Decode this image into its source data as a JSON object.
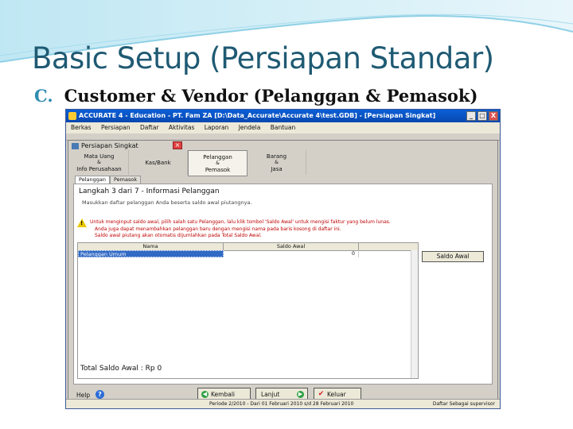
{
  "slide": {
    "title": "Basic Setup (Persiapan Standar)",
    "subtitle_letter": "C.",
    "subtitle": "Customer & Vendor (Pelanggan & Pemasok)",
    "accent_color": "#2f8cb0"
  },
  "window": {
    "title": "ACCURATE 4 - Education - PT. Fam ZA  [D:\\Data_Accurate\\Accurate 4\\test.GDB] - [Persiapan Singkat]",
    "buttons": [
      "_",
      "□",
      "X"
    ]
  },
  "menu": [
    "Berkas",
    "Persiapan",
    "Daftar",
    "Aktivitas",
    "Laporan",
    "Jendela",
    "Bantuan"
  ],
  "child_window": {
    "title": "Persiapan Singkat",
    "steps": [
      {
        "line1": "Mata Uang",
        "line2": "&",
        "line3": "Info Perusahaan"
      },
      {
        "line1": "Kas/Bank",
        "line2": "",
        "line3": ""
      },
      {
        "line1": "Pelanggan",
        "line2": "&",
        "line3": "Pemasok"
      },
      {
        "line1": "Barang",
        "line2": "&",
        "line3": "Jasa"
      }
    ],
    "tabs": [
      "Pelanggan",
      "Pemasok"
    ],
    "step_heading": "Langkah 3 dari 7 - Informasi Pelanggan",
    "instruction": "Masukkan daftar pelanggan Anda beserta saldo awal piutangnya.",
    "warning_line1": "Untuk menginput saldo awal, pilih salah satu Pelanggan, lalu klik tombol 'Saldo Awal' untuk mengisi faktur yang belum lunas.",
    "warning_line2": "Anda juga dapat menambahkan pelanggan baru dengan mengisi nama pada baris kosong di daftar ini.",
    "warning_line3": "Saldo awal piutang akan otomatis dijumlahkan pada Total Saldo Awal.",
    "grid": {
      "columns": [
        "Nama",
        "Saldo Awal"
      ],
      "rows": [
        {
          "name": "Pelanggan Umum",
          "saldo": "0"
        }
      ]
    },
    "saldo_button": "Saldo Awal",
    "total": "Total Saldo Awal : Rp 0",
    "help": "Help",
    "back_button": "Kembali",
    "next_button": "Lanjut",
    "exit_button": "Keluar"
  },
  "status": {
    "left": "Periode 2/2010 - Dari 01 Februari 2010 s/d 28 Februari 2010",
    "right": "Daftar Sebagai supervisor"
  }
}
